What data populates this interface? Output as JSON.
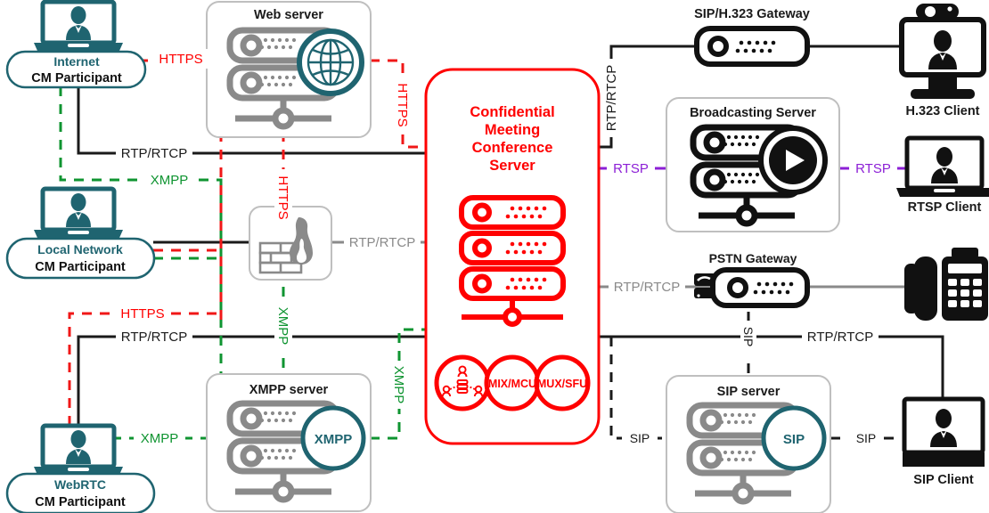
{
  "diagram": {
    "title": "Confidential Meeting Conference Server Architecture",
    "colors": {
      "teal": "#1f6470",
      "teal_dark": "#215c68",
      "red": "#ff0000",
      "red_line": "#f01717",
      "green": "#0f9431",
      "green_dark": "#13862f",
      "purple": "#8c1fd6",
      "gray": "#8a8a8a",
      "gray_light": "#bfbfbf",
      "black": "#111111",
      "dark_text": "#1a1a1a"
    },
    "central": {
      "name": "confidential-meeting-conference-server",
      "title_lines": [
        "Confidential",
        "Meeting",
        "Conference",
        "Server"
      ],
      "badges": [
        {
          "id": "participants",
          "label": "",
          "icon": "people-network-icon"
        },
        {
          "id": "mix-mcu",
          "label": "MIX/MCU",
          "icon": "none"
        },
        {
          "id": "mux-sfu",
          "label": "MUX/SFU",
          "icon": "none"
        }
      ]
    },
    "participants": [
      {
        "id": "internet-cm-participant",
        "top": "Internet",
        "bottom": "CM Participant",
        "icon": "laptop-user-icon"
      },
      {
        "id": "local-network-cm-participant",
        "top": "Local Network",
        "bottom": "CM Participant",
        "icon": "laptop-user-icon"
      },
      {
        "id": "webrtc-cm-participant",
        "top": "WebRTC",
        "bottom": "CM Participant",
        "icon": "laptop-user-icon"
      }
    ],
    "servers": [
      {
        "id": "web-server",
        "label": "Web server",
        "icon": "server-rack-icon",
        "badge": "globe-icon",
        "badge_label": ""
      },
      {
        "id": "xmpp-server",
        "label": "XMPP server",
        "icon": "server-rack-icon",
        "badge": "circle-badge",
        "badge_label": "XMPP"
      },
      {
        "id": "sip-server",
        "label": "SIP server",
        "icon": "server-rack-icon",
        "badge": "circle-badge",
        "badge_label": "SIP"
      },
      {
        "id": "broadcasting-server",
        "label": "Broadcasting Server",
        "icon": "server-rack-icon",
        "badge": "play-icon",
        "badge_label": ""
      }
    ],
    "firewall": {
      "id": "firewall",
      "label": "",
      "icon": "firewall-brick-flame-icon"
    },
    "gateways": [
      {
        "id": "sip-h323-gateway",
        "label": "SIP/H.323 Gateway",
        "icon": "gateway-device-icon"
      },
      {
        "id": "pstn-gateway",
        "label": "PSTN Gateway",
        "icon": "gateway-device-phone-icon"
      }
    ],
    "clients": [
      {
        "id": "h323-client",
        "label": "H.323 Client",
        "icon": "video-monitor-icon"
      },
      {
        "id": "rtsp-client",
        "label": "RTSP Client",
        "icon": "laptop-user-icon"
      },
      {
        "id": "sip-client",
        "label": "SIP Client",
        "icon": "laptop-user-icon"
      },
      {
        "id": "pstn-phone",
        "label": "",
        "icon": "desk-phone-fax-icon"
      }
    ],
    "protocol_labels": [
      {
        "id": "https-1",
        "text": "HTTPS",
        "color": "#ff0000",
        "orientation": "horizontal"
      },
      {
        "id": "https-2",
        "text": "HTTPS",
        "color": "#ff0000",
        "orientation": "vertical"
      },
      {
        "id": "https-3",
        "text": "HTTPS",
        "color": "#ff0000",
        "orientation": "vertical"
      },
      {
        "id": "https-4",
        "text": "HTTPS",
        "color": "#ff0000",
        "orientation": "horizontal"
      },
      {
        "id": "rtp-rtcp-1",
        "text": "RTP/RTCP",
        "color": "#1a1a1a",
        "orientation": "horizontal"
      },
      {
        "id": "xmpp-1",
        "text": "XMPP",
        "color": "#0f9431",
        "orientation": "horizontal"
      },
      {
        "id": "rtp-rtcp-2",
        "text": "RTP/RTCP",
        "color": "#8a8a8a",
        "orientation": "horizontal"
      },
      {
        "id": "rtp-rtcp-3",
        "text": "RTP/RTCP",
        "color": "#1a1a1a",
        "orientation": "horizontal"
      },
      {
        "id": "xmpp-2",
        "text": "XMPP",
        "color": "#0f9431",
        "orientation": "vertical"
      },
      {
        "id": "xmpp-3",
        "text": "XMPP",
        "color": "#0f9431",
        "orientation": "vertical"
      },
      {
        "id": "xmpp-4",
        "text": "XMPP",
        "color": "#0f9431",
        "orientation": "horizontal"
      },
      {
        "id": "rtp-rtcp-4",
        "text": "RTP/RTCP",
        "color": "#1a1a1a",
        "orientation": "vertical"
      },
      {
        "id": "rtsp-1",
        "text": "RTSP",
        "color": "#8c1fd6",
        "orientation": "horizontal"
      },
      {
        "id": "rtsp-2",
        "text": "RTSP",
        "color": "#8c1fd6",
        "orientation": "horizontal"
      },
      {
        "id": "rtp-rtcp-5",
        "text": "RTP/RTCP",
        "color": "#8a8a8a",
        "orientation": "horizontal"
      },
      {
        "id": "rtp-rtcp-6",
        "text": "RTP/RTCP",
        "color": "#1a1a1a",
        "orientation": "horizontal"
      },
      {
        "id": "sip-1",
        "text": "SIP",
        "color": "#1a1a1a",
        "orientation": "vertical"
      },
      {
        "id": "sip-2",
        "text": "SIP",
        "color": "#1a1a1a",
        "orientation": "horizontal"
      },
      {
        "id": "sip-3",
        "text": "SIP",
        "color": "#1a1a1a",
        "orientation": "horizontal"
      }
    ]
  }
}
